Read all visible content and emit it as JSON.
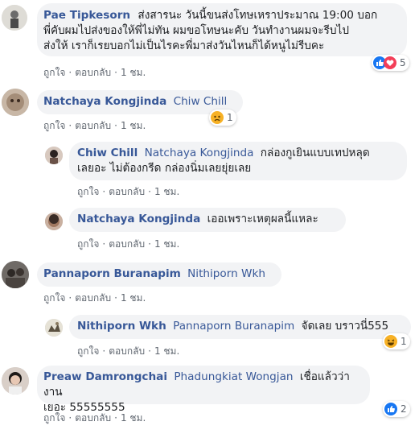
{
  "action_like": "ถูกใจ",
  "action_reply": "ตอบกลับ",
  "action_time": "1 ชม.",
  "separator": "·",
  "comments": [
    {
      "name": "Pae Tipkesorn",
      "tag": "",
      "text_lines": [
        "ส่งสารนะ วันนี้ขนส่งโทษเหราประมาณ 19:00 บอก",
        "พี่คับผมไปส่งของให้พี่ไม่ทัน ผมขอโทษนะคับ วันทำงานผมจะรีบไป",
        "ส่งให้ เราก็เรยบอกไม่เป็นไรคะพี่มาส่งวันไหนก็ได้หนูไม่รีบคะ"
      ],
      "reaction_count": "5",
      "reaction_icons": [
        "like-icon",
        "love-icon"
      ]
    },
    {
      "name": "Natchaya Kongjinda",
      "tag": "Chiw Chill",
      "text": "",
      "reaction_count": "1",
      "reaction_icons": [
        "sad-icon"
      ]
    },
    {
      "name": "Chiw Chill",
      "tag": "Natchaya Kongjinda",
      "text_line1": "กล่องกูเยินแบบเทปหลุด",
      "text_line2": "เลยอะ ไม่ต้องกรีด กล่องนิ่มเลยยุ่ยเลย"
    },
    {
      "name": "Natchaya Kongjinda",
      "tag": "",
      "text": "เออเพราะเหตุผลนี้แหละ"
    },
    {
      "name": "Pannaporn Buranapim",
      "tag": "Nithiporn Wkh",
      "text": ""
    },
    {
      "name": "Nithiporn Wkh",
      "tag": "Pannaporn Buranapim",
      "text": "จัดเลย บราวนี่555",
      "reaction_count": "1",
      "reaction_icons": [
        "haha-icon"
      ]
    },
    {
      "name": "Preaw Damrongchai",
      "tag": "Phadungkiat Wongjan",
      "text_line1": "เชื่อแล้วว่างาน",
      "text_line2": "เยอะ 55555555",
      "reaction_count": "2",
      "reaction_icons": [
        "like-icon"
      ]
    }
  ],
  "colors": {
    "name": "#385898",
    "bubble": "#f2f3f5",
    "meta": "#606770",
    "like": "#1877f2",
    "love": "#f33e58",
    "emoji": "#f7b125"
  }
}
